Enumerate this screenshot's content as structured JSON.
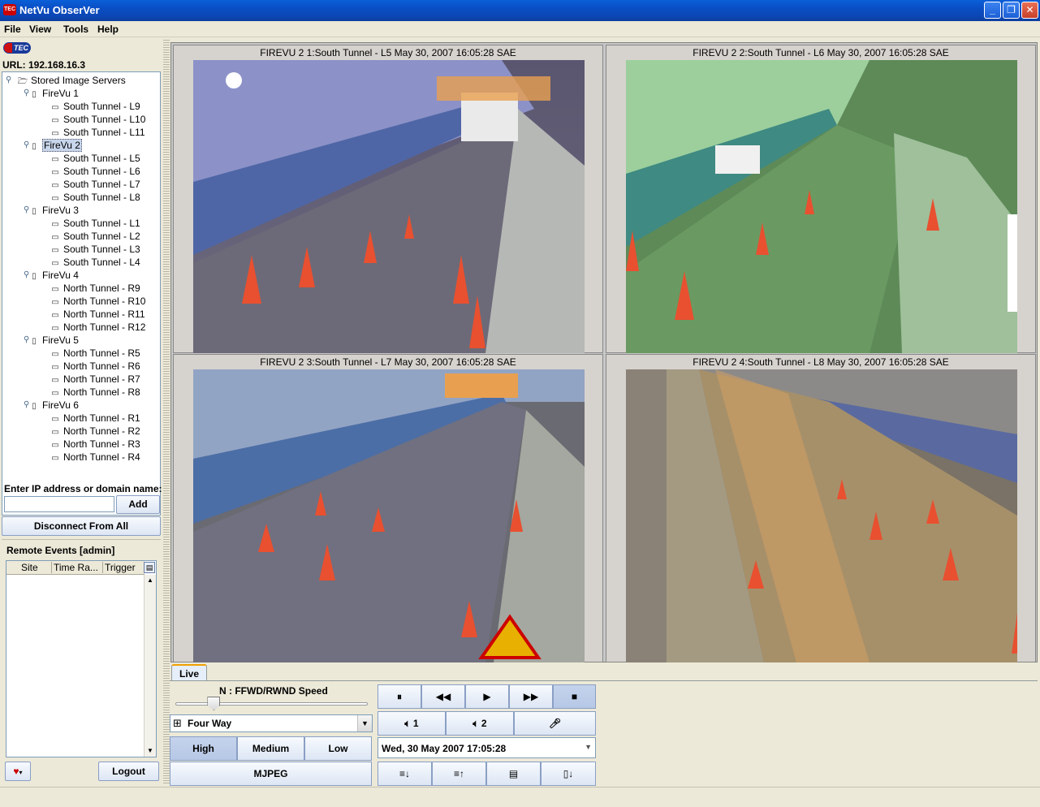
{
  "window": {
    "title": "NetVu ObserVer",
    "controls": [
      "minimize",
      "restore",
      "close"
    ]
  },
  "menu": [
    "File",
    "View",
    "Tools",
    "Help"
  ],
  "left": {
    "logo_text": "TEC",
    "url_label": "URL: 192.168.16.3",
    "tree": {
      "root": "Stored Image Servers",
      "servers": [
        {
          "name": "FireVu 1",
          "cameras": [
            "South Tunnel - L9",
            "South Tunnel - L10",
            "South Tunnel - L11"
          ]
        },
        {
          "name": "FireVu 2",
          "cameras": [
            "South Tunnel - L5",
            "South Tunnel - L6",
            "South Tunnel - L7",
            "South Tunnel - L8"
          ]
        },
        {
          "name": "FireVu 3",
          "cameras": [
            "South Tunnel - L1",
            "South Tunnel - L2",
            "South Tunnel - L3",
            "South Tunnel - L4"
          ]
        },
        {
          "name": "FireVu 4",
          "cameras": [
            "North Tunnel - R9",
            "North Tunnel - R10",
            "North Tunnel - R11",
            "North Tunnel - R12"
          ]
        },
        {
          "name": "FireVu 5",
          "cameras": [
            "North Tunnel - R5",
            "North Tunnel - R6",
            "North Tunnel - R7",
            "North Tunnel - R8"
          ]
        },
        {
          "name": "FireVu 6",
          "cameras": [
            "North Tunnel - R1",
            "North Tunnel - R2",
            "North Tunnel - R3",
            "North Tunnel - R4"
          ]
        }
      ],
      "selected": "FireVu 2"
    },
    "ip_label": "Enter IP address or domain name:",
    "ip_value": "",
    "add_button": "Add",
    "disconnect_button": "Disconnect From All",
    "remote_events": {
      "title": "Remote Events [admin]",
      "columns": [
        "Site",
        "Time Ra...",
        "Trigger"
      ],
      "rows": []
    },
    "logout_button": "Logout"
  },
  "cameras": [
    {
      "caption": "FIREVU 2 1:South Tunnel - L5 May 30, 2007 16:05:28 SAE",
      "tint": "purple"
    },
    {
      "caption": "FIREVU 2 2:South Tunnel - L6 May 30, 2007 16:05:28 SAE",
      "tint": "green"
    },
    {
      "caption": "FIREVU 2 3:South Tunnel - L7 May 30, 2007 16:05:28 SAE",
      "tint": "blue"
    },
    {
      "caption": "FIREVU 2 4:South Tunnel - L8 May 30, 2007 16:05:28 SAE",
      "tint": "orange"
    }
  ],
  "controls": {
    "tab": "Live",
    "speed_label": "N : FFWD/RWND Speed",
    "speed_value": 0.2,
    "layout_select": "Four Way",
    "quality": [
      "High",
      "Medium",
      "Low"
    ],
    "quality_selected": "High",
    "format_button": "MJPEG",
    "playback": [
      "pause",
      "rewind",
      "play",
      "fast-forward",
      "stop"
    ],
    "audio_1": "1",
    "audio_2": "2",
    "datetime": "Wed, 30 May 2007 17:05:28"
  }
}
